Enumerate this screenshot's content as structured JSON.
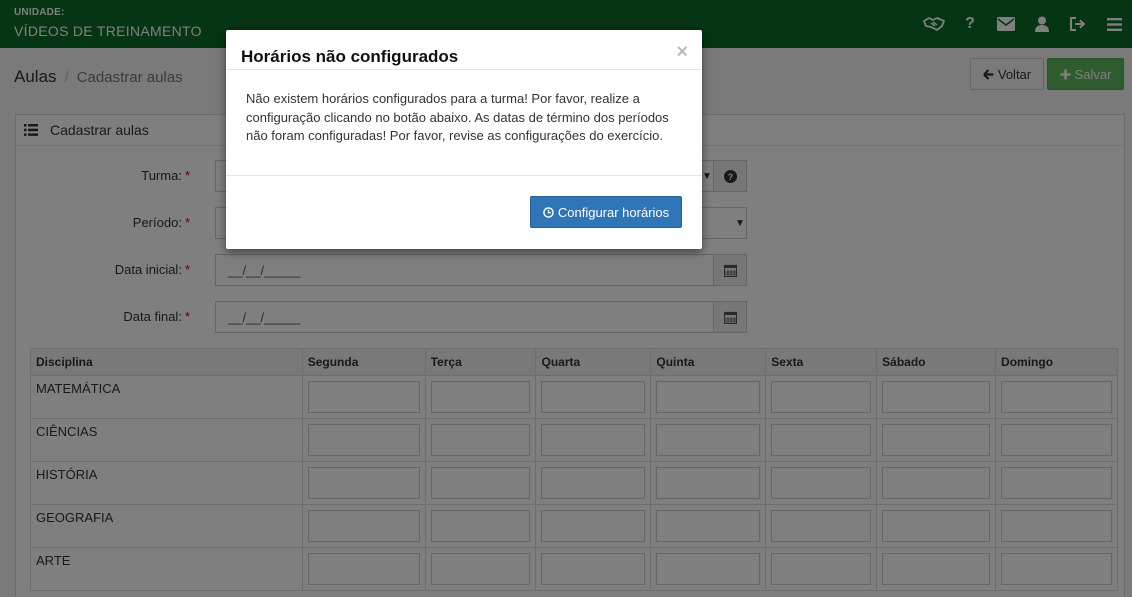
{
  "topbar": {
    "unit_label": "UNIDADE:",
    "unit_name": "VÍDEOS DE TREINAMENTO",
    "icons": [
      "handshake-icon",
      "help-icon",
      "envelope-icon",
      "user-icon",
      "logout-icon",
      "menu-icon"
    ],
    "help_glyph": "?"
  },
  "header": {
    "title": "Aulas",
    "separator": "/",
    "subtitle": "Cadastrar aulas",
    "back_label": "Voltar",
    "save_label": "Salvar"
  },
  "panel": {
    "title": "Cadastrar aulas"
  },
  "form": {
    "turma_label": "Turma:",
    "periodo_label": "Período:",
    "data_inicial_label": "Data inicial:",
    "data_inicial_value": "__/__/_____",
    "data_final_label": "Data final:",
    "data_final_value": "__/__/_____",
    "required_mark": "*"
  },
  "table": {
    "headers": [
      "Disciplina",
      "Segunda",
      "Terça",
      "Quarta",
      "Quinta",
      "Sexta",
      "Sábado",
      "Domingo"
    ],
    "rows": [
      "MATEMÁTICA",
      "CIÊNCIAS",
      "HISTÓRIA",
      "GEOGRAFIA",
      "ARTE"
    ]
  },
  "modal": {
    "title": "Horários não configurados",
    "close": "×",
    "body": "Não existem horários configurados para a turma! Por favor, realize a configuração clicando no botão abaixo. As datas de término dos períodos não foram configuradas! Por favor, revise as configurações do exercício.",
    "button_label": "Configurar horários"
  },
  "colors": {
    "topbar": "#0b6b25",
    "primary": "#3075b6",
    "success": "#5cb85c"
  }
}
